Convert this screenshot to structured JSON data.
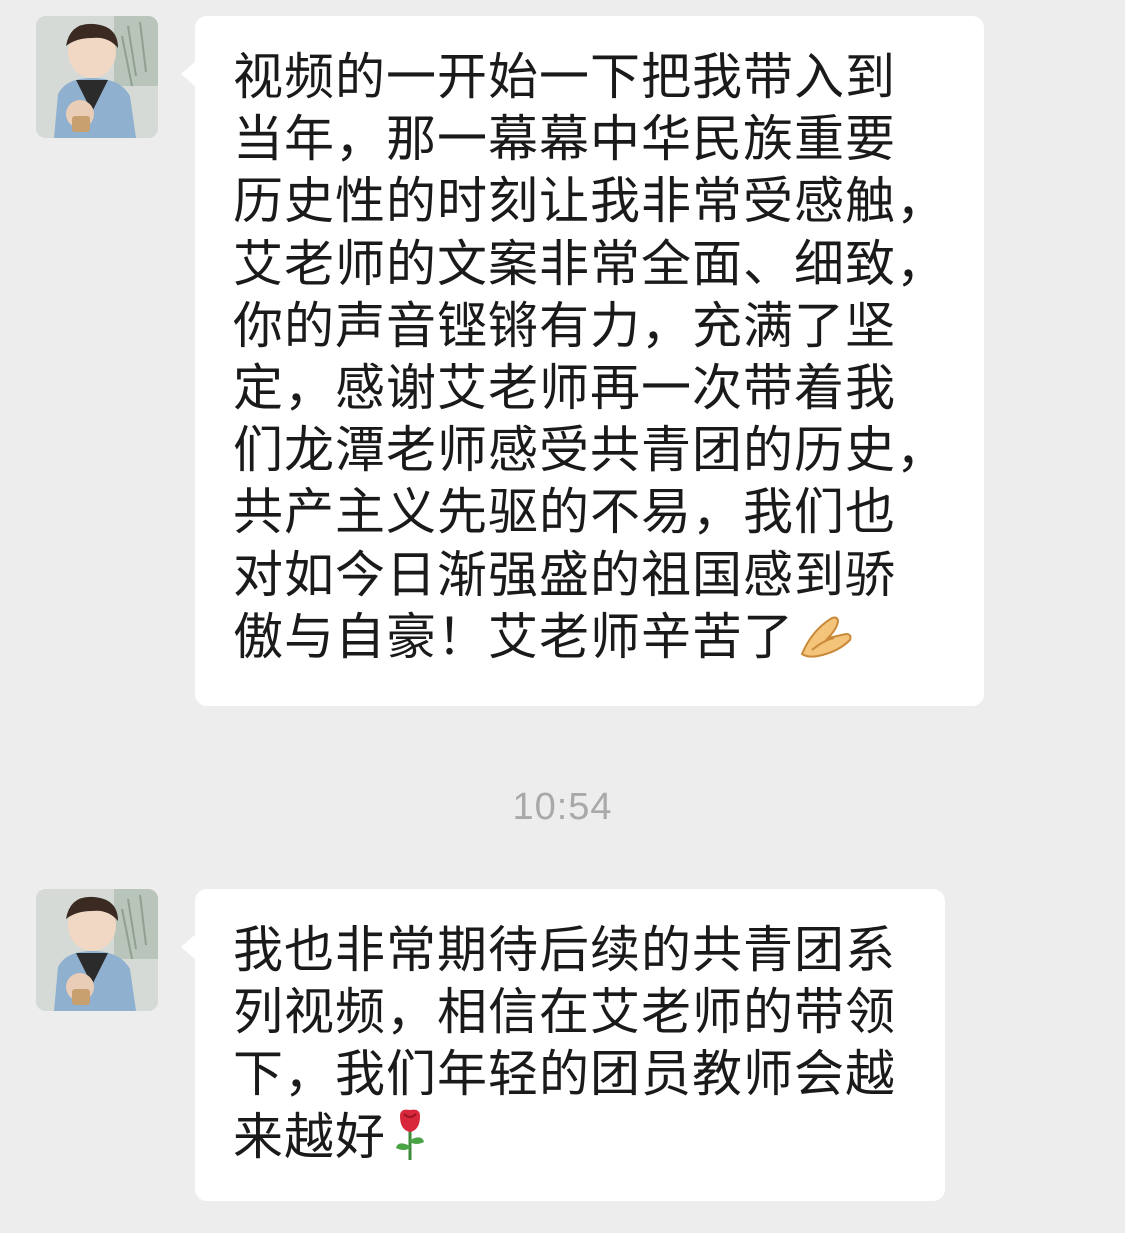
{
  "messages": [
    {
      "text": "视频的一开始一下把我带入到\n当年，那一幕幕中华民族重要\n历史性的时刻让我非常受感触，\n艾老师的文案非常全面、细致，\n你的声音铿锵有力，充满了坚\n定，感谢艾老师再一次带着我\n们龙潭老师感受共青团的历史，\n共产主义先驱的不易，我们也\n对如今日渐强盛的祖国感到骄\n傲与自豪！艾老师辛苦了",
      "emoji": "folded-hands-emoji"
    },
    {
      "text": "我也非常期待后续的共青团系\n列视频，相信在艾老师的带领\n下，我们年轻的团员教师会越\n来越好",
      "emoji": "rose-emoji"
    }
  ],
  "timestamp": "10:54",
  "colors": {
    "background": "#ededed",
    "bubble": "#ffffff",
    "text": "#1a1a1a",
    "timestamp": "#a9a9a9"
  }
}
